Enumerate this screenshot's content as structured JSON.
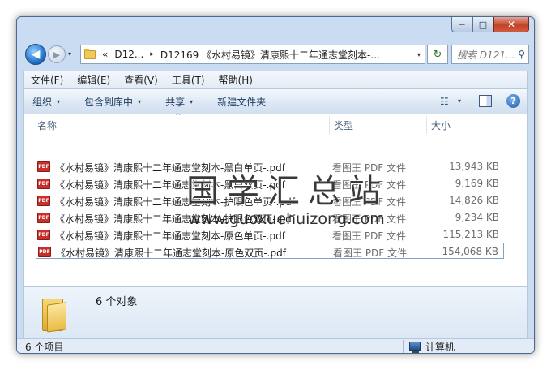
{
  "window": {
    "minimize_glyph": "─",
    "maximize_glyph": "□",
    "close_glyph": "✕"
  },
  "nav": {
    "back_glyph": "◀",
    "forward_glyph": "▶",
    "dropdown_glyph": "▾"
  },
  "address": {
    "overflow": "«",
    "segment1": "D12...",
    "separator": "▸",
    "segment2": "D12169 《水村易镜》清康熙十二年通志堂刻本-...",
    "dropdown": "▾",
    "refresh_glyph": "↻"
  },
  "search": {
    "placeholder": "搜索 D121...",
    "icon": "search-icon"
  },
  "menu": [
    {
      "label": "文件(F)"
    },
    {
      "label": "编辑(E)"
    },
    {
      "label": "查看(V)"
    },
    {
      "label": "工具(T)"
    },
    {
      "label": "帮助(H)"
    }
  ],
  "toolbar": {
    "organize": "组织",
    "include_library": "包含到库中",
    "share": "共享",
    "new_folder": "新建文件夹",
    "arrow": "▾",
    "view_glyph": "☷",
    "help_glyph": "?"
  },
  "columns": {
    "name": "名称",
    "type": "类型",
    "size": "大小",
    "sort_caret": "^"
  },
  "files": [
    {
      "name": "《水村易镜》清康熙十二年通志堂刻本-黑白单页-.pdf",
      "type": "看图王 PDF 文件",
      "size": "13,943 KB",
      "icon_label": "PDF"
    },
    {
      "name": "《水村易镜》清康熙十二年通志堂刻本-黑白双页-.pdf",
      "type": "看图王 PDF 文件",
      "size": "9,169 KB",
      "icon_label": "PDF"
    },
    {
      "name": "《水村易镜》清康熙十二年通志堂刻本-护眼色单页-.pdf",
      "type": "看图王 PDF 文件",
      "size": "14,826 KB",
      "icon_label": "PDF"
    },
    {
      "name": "《水村易镜》清康熙十二年通志堂刻本-护眼色双页-.pdf",
      "type": "看图王 PDF 文件",
      "size": "9,234 KB",
      "icon_label": "PDF"
    },
    {
      "name": "《水村易镜》清康熙十二年通志堂刻本-原色单页-.pdf",
      "type": "看图王 PDF 文件",
      "size": "115,213 KB",
      "icon_label": "PDF"
    },
    {
      "name": "《水村易镜》清康熙十二年通志堂刻本-原色双页-.pdf",
      "type": "看图王 PDF 文件",
      "size": "154,068 KB",
      "icon_label": "PDF"
    }
  ],
  "watermark": {
    "text": "国学汇总站",
    "url": "www.guoxuehuizong.com"
  },
  "details": {
    "count_text": "6 个对象"
  },
  "status": {
    "items_text": "6 个项目",
    "location_text": "计算机"
  }
}
